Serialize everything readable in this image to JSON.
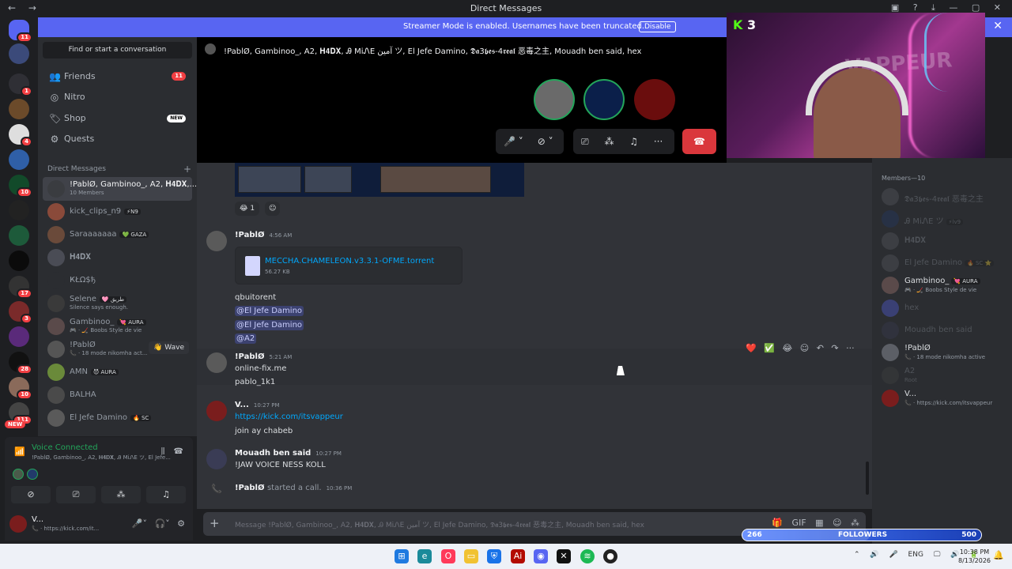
{
  "window": {
    "title": "Direct Messages",
    "nav_icons": "← →",
    "controls": "▣ ? ⤓ — ▢ ✕"
  },
  "banner": {
    "message": "Streamer Mode is enabled. Usernames have been truncated.",
    "button": "Disable",
    "close": "✕"
  },
  "rail": {
    "badges": [
      "11",
      "1",
      "4",
      "10",
      "17",
      "3",
      "28",
      "10",
      "111",
      "NEW"
    ]
  },
  "sidebar": {
    "search_label": "Find or start a conversation",
    "nav": [
      {
        "label": "Friends",
        "icon": "👥",
        "badge": "11"
      },
      {
        "label": "Nitro",
        "icon": "◎",
        "badge": ""
      },
      {
        "label": "Shop",
        "icon": "🏷",
        "badge": "NEW"
      },
      {
        "label": "Quests",
        "icon": "⚙",
        "badge": ""
      }
    ],
    "dm_header": "Direct Messages",
    "dm_header_add": "+",
    "dms": [
      {
        "name": "!PablØ, Gambinoo_, A2, 𝐇𝟒𝐃𝐗,...",
        "sub": "10 Members",
        "tag": ""
      },
      {
        "name": "kick_clips_n9",
        "sub": "",
        "tag": "⚡N9"
      },
      {
        "name": "Saraaaaaaa",
        "sub": "",
        "tag": "💚 GAZA"
      },
      {
        "name": "𝐇𝟒𝐃𝐗",
        "sub": "",
        "tag": ""
      },
      {
        "name": "ҜŁΩ$ђ",
        "sub": "",
        "tag": ""
      },
      {
        "name": "Selene",
        "sub": "Silence says enough.",
        "tag": "🩷 طريق"
      },
      {
        "name": "Gambinoo_",
        "sub": "🎮 · 🏒 Boobs Style de vie",
        "tag": "💘 AURA"
      },
      {
        "name": "!PablØ",
        "sub": "📞 · 18 mode nikomha act...",
        "tag": "",
        "wave": "👋 Wave"
      },
      {
        "name": "AMN",
        "sub": "",
        "tag": "😈 AURA"
      },
      {
        "name": "BALHA",
        "sub": "",
        "tag": ""
      },
      {
        "name": "El Jefe Damino",
        "sub": "",
        "tag": "🔥 SC"
      }
    ]
  },
  "voice": {
    "title": "Voice Connected",
    "channel": "!PablØ, Gambinoo_, A2, 𝐇𝟒𝐃𝐗, Ꭿ MiᏁE ツ, El Jefe...",
    "icons": "⫼ ☎"
  },
  "user": {
    "name": "V...",
    "status": "📞 · https://kick.com/it...",
    "controls": "🎤˅ 🎧˅ ⚙"
  },
  "call": {
    "title": "!PablØ, Gambinoo_, A2, 𝐇𝟒𝐃𝐗, Ꭿ MiᏁE ﺁﻣﻴﻦ ツ, El Jefe Damino, 𝕯𝖆3𝖇𝖊𝖘-4𝖗𝖊𝖆𝖑 恶毒之主, Mouadh ben said, hex",
    "mic": "🎤 ˅",
    "cam": "⊘ ˅",
    "screen": "⎚",
    "activities": "⁂",
    "soundboard": "♫",
    "more": "···",
    "hangup": "☎"
  },
  "cam_overlay": {
    "kick_logo": "K",
    "viewers": "3",
    "wall_text": "VAPPEUR"
  },
  "chat": {
    "reaction_emoji": "😂",
    "reaction_count": "1",
    "add_reaction": "☺",
    "messages": [
      {
        "author": "!PablØ",
        "time": "4:56 AM",
        "file_name": "MECCHA.CHAMELEON.v3.3.1-OFME.torrent",
        "file_size": "56.27 KB",
        "lines": [
          "qbuitorent",
          "@El Jefe Damino",
          "@El Jefe Damino",
          "@A2"
        ]
      },
      {
        "author": "!PablØ",
        "time": "5:21 AM",
        "lines": [
          "online-fix.me",
          "pablo_1k1"
        ]
      },
      {
        "author": "V...",
        "time": "10:27 PM",
        "lines": [
          "https://kick.com/itsvappeur",
          "join  ay  chabeb"
        ]
      },
      {
        "author": "Mouadh ben said",
        "time": "10:27 PM",
        "lines": [
          "!JAW VOICE NESS KOLL"
        ]
      },
      {
        "author": "!PablØ",
        "action": "started a call.",
        "time": "10:36 PM"
      }
    ],
    "hover_toolbar": "❤️ ✅ 😂 ☺ ↶ ↷ ···"
  },
  "composer": {
    "plus": "+",
    "placeholder": "Message !PablØ, Gambinoo_, A2, 𝐇𝟒𝐃𝐗, Ꭿ MiᏁE ﺁﻣﻴﻦ ツ, El Jefe Damino, 𝕯𝖆3𝖇𝖊𝖘-4𝖗𝖊𝖆𝖑 恶毒之主, Mouadh ben said, hex",
    "tools": "🎁 GIF ▦ ☺ ⁂"
  },
  "members": {
    "header": "Members—10",
    "list": [
      {
        "name": "𝕯𝖆3𝖇𝖊𝖘-4𝖗𝖊𝖆𝖑 恶毒之主",
        "sub": "",
        "dim": true
      },
      {
        "name": "Ꭿ MiᏁE ツ",
        "sub": "",
        "tag": "⚡lv9",
        "dim": true
      },
      {
        "name": "𝐇𝟒𝐃𝐗",
        "sub": "",
        "dim": true
      },
      {
        "name": "El Jefe Damino",
        "sub": "",
        "tag": "🔥 SC ⭐",
        "dim": true
      },
      {
        "name": "Gambinoo_",
        "sub": "🎮 · 🏒 Boobs Style de vie",
        "tag": "💘 AURA",
        "dim": false
      },
      {
        "name": "hex",
        "sub": "",
        "dim": true
      },
      {
        "name": "Mouadh ben said",
        "sub": "",
        "dim": true
      },
      {
        "name": "!PablØ",
        "sub": "📞 · 18 mode nikomha active",
        "dim": false
      },
      {
        "name": "A2",
        "sub": "Root",
        "dim": true
      },
      {
        "name": "V...",
        "sub": "📞 · https://kick.com/itsvappeur",
        "dim": false
      }
    ]
  },
  "followers": {
    "current": "266",
    "label": "FOLLOWERS",
    "goal": "500",
    "progress": 0.532
  },
  "taskbar": {
    "tray": "⌃ 🔊 🎤 ENG 🖵 🔊 🔋",
    "time": "10:38 PM",
    "date": "8/13/2026",
    "bell": "🔔"
  }
}
